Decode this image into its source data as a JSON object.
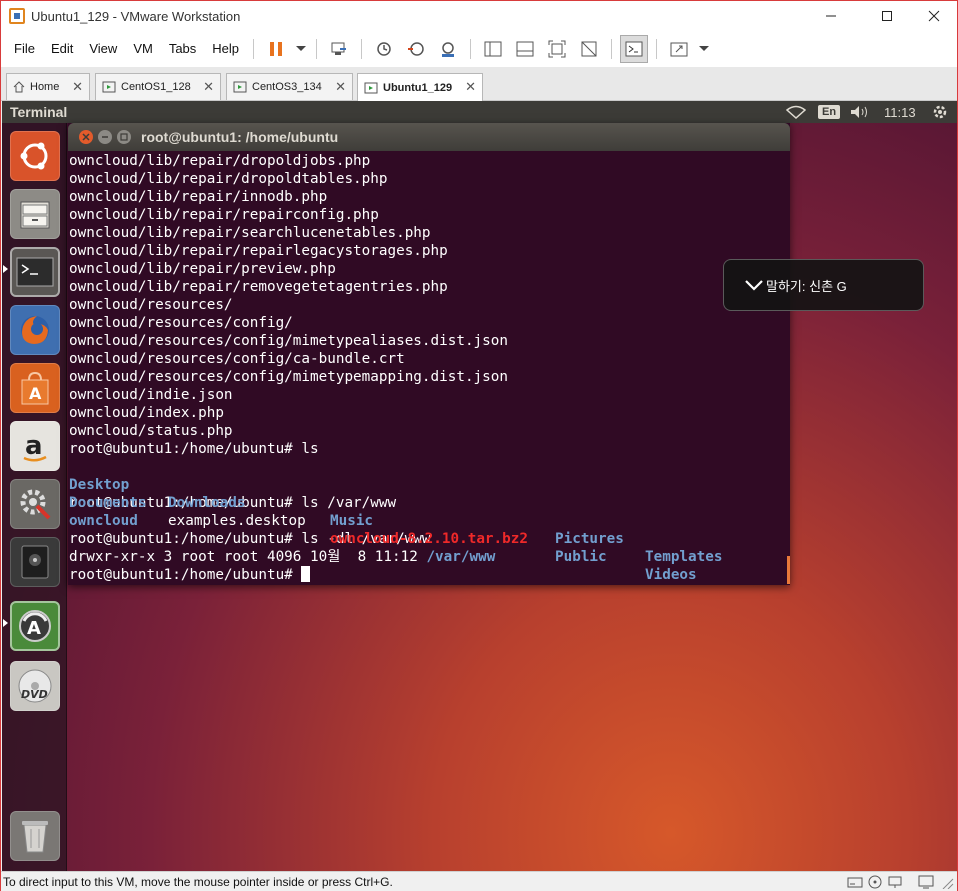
{
  "window": {
    "title": "Ubuntu1_129 - VMware Workstation"
  },
  "menubar": {
    "items": [
      "File",
      "Edit",
      "View",
      "VM",
      "Tabs",
      "Help"
    ]
  },
  "tabs": [
    {
      "label": "Home",
      "icon": "home-icon"
    },
    {
      "label": "CentOS1_128",
      "icon": "vm-icon"
    },
    {
      "label": "CentOS3_134",
      "icon": "vm-icon"
    },
    {
      "label": "Ubuntu1_129",
      "icon": "vm-icon",
      "active": true
    }
  ],
  "ubuntu_panel": {
    "title": "Terminal",
    "lang": "En",
    "time": "11:13"
  },
  "launcher": {
    "items": [
      "dash-home-icon",
      "files-icon",
      "terminal-icon",
      "firefox-icon",
      "software-center-icon",
      "amazon-icon",
      "system-settings-icon",
      "disks-icon",
      "software-updater-icon",
      "dvd-icon",
      "trash-icon"
    ]
  },
  "terminal": {
    "title": "root@ubuntu1: /home/ubuntu",
    "lines": [
      "owncloud/lib/repair/dropoldjobs.php",
      "owncloud/lib/repair/dropoldtables.php",
      "owncloud/lib/repair/innodb.php",
      "owncloud/lib/repair/repairconfig.php",
      "owncloud/lib/repair/searchlucenetables.php",
      "owncloud/lib/repair/repairlegacystorages.php",
      "owncloud/lib/repair/preview.php",
      "owncloud/lib/repair/removegetetagentries.php",
      "owncloud/resources/",
      "owncloud/resources/config/",
      "owncloud/resources/config/mimetypealiases.dist.json",
      "owncloud/resources/config/ca-bundle.crt",
      "owncloud/resources/config/mimetypemapping.dist.json",
      "owncloud/indie.json",
      "owncloud/index.php",
      "owncloud/status.php",
      "root@ubuntu1:/home/ubuntu# ls"
    ],
    "ls_output": {
      "row1": [
        "Desktop",
        "Downloads",
        "Music",
        "Pictures",
        "Templates"
      ],
      "row2": [
        "Documents",
        "examples.desktop",
        "owncloud-8.2.10.tar.bz2",
        "Public",
        "Videos"
      ]
    },
    "cmd_ls_www": "root@ubuntu1:/home/ubuntu# ls /var/www",
    "owncloud_dir": "owncloud",
    "cmd_ls_dl": "root@ubuntu1:/home/ubuntu# ls -dl /var/www",
    "dl_result": "drwxr-xr-x 3 root root 4096 10월  8 11:12 ",
    "dl_path": "/var/www",
    "prompt": "root@ubuntu1:/home/ubuntu# "
  },
  "notification": {
    "text": "말하기: 신촌 G"
  },
  "statusbar": {
    "text": "To direct input to this VM, move the mouse pointer inside or press Ctrl+G."
  }
}
